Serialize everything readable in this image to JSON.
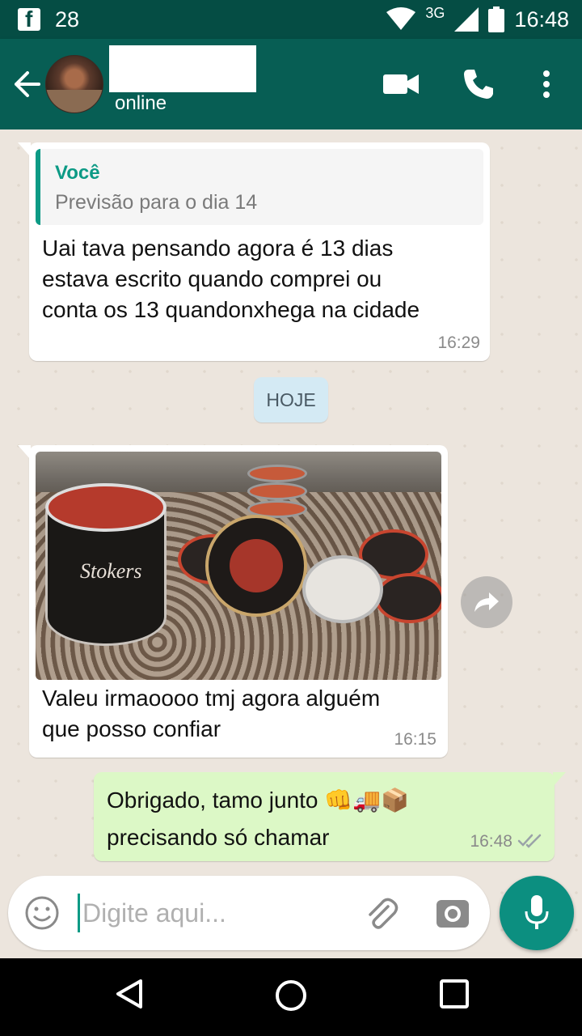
{
  "status_bar": {
    "notification_count": "28",
    "network": "3G",
    "time": "16:48"
  },
  "header": {
    "presence": "online"
  },
  "chat": {
    "messages": [
      {
        "direction": "in",
        "quote": {
          "author": "Você",
          "text": "Previsão para o dia 14"
        },
        "lines": [
          "Uai tava pensando agora é 13 dias",
          "estava escrito quando comprei ou",
          "conta os 13 quandonxhega na cidade"
        ],
        "time": "16:29"
      },
      {
        "direction": "in",
        "image": "photo",
        "lines": [
          "Valeu irmaoooo tmj agora alguém",
          "que posso confiar"
        ],
        "time": "16:15"
      },
      {
        "direction": "out",
        "lines": [
          "Obrigado, tamo junto 👊🚚📦",
          "precisando só chamar"
        ],
        "time": "16:48",
        "status": "read"
      }
    ],
    "date_separator": "HOJE"
  },
  "input": {
    "placeholder": "Digite aqui..."
  },
  "icons": {
    "back": "arrow-left-icon",
    "video": "video-call-icon",
    "phone": "phone-icon",
    "menu": "more-vert-icon",
    "emoji": "emoji-icon",
    "attach": "paperclip-icon",
    "camera": "camera-icon",
    "mic": "mic-icon",
    "forward": "forward-icon"
  },
  "colors": {
    "header": "#075e54",
    "status_bar": "#054d44",
    "accent": "#0c9a85",
    "outgoing_bubble": "#dcf8c6",
    "incoming_bubble": "#ffffff",
    "chat_bg": "#ece5dd"
  }
}
